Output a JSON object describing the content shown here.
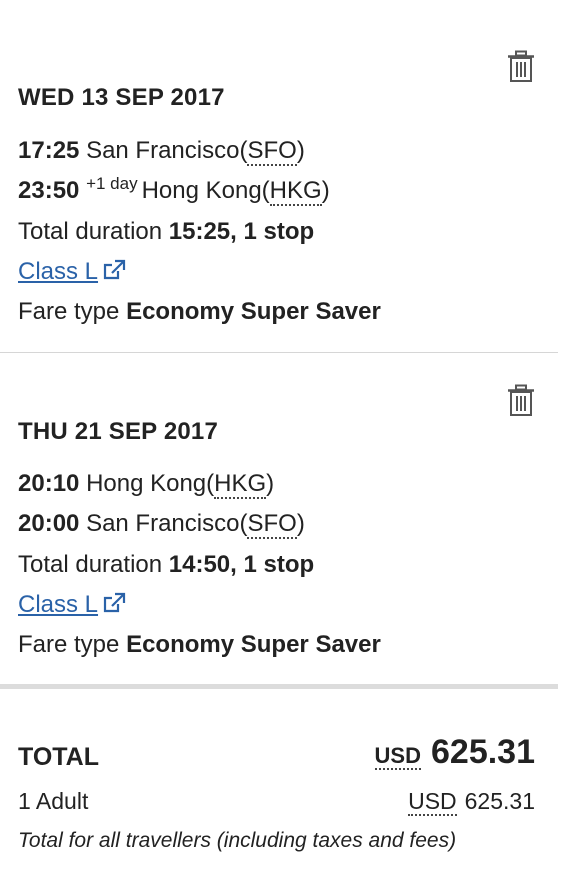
{
  "segments": [
    {
      "date": "WED 13 SEP 2017",
      "depart_time": "17:25",
      "depart_city": "San Francisco",
      "depart_code": "SFO",
      "arrive_time": "23:50",
      "arrive_day_offset": "+1 day",
      "arrive_city": "Hong Kong",
      "arrive_code": "HKG",
      "duration_label": "Total duration",
      "duration_value": "15:25, 1 stop",
      "class_link": "Class L",
      "fare_label": "Fare type",
      "fare_value": "Economy Super Saver"
    },
    {
      "date": "THU 21 SEP 2017",
      "depart_time": "20:10",
      "depart_city": "Hong Kong",
      "depart_code": "HKG",
      "arrive_time": "20:00",
      "arrive_city": "San Francisco",
      "arrive_code": "SFO",
      "duration_label": "Total duration",
      "duration_value": "14:50, 1 stop",
      "class_link": "Class L",
      "fare_label": "Fare type",
      "fare_value": "Economy Super Saver"
    }
  ],
  "total": {
    "label": "TOTAL",
    "currency": "USD",
    "amount": "625.31",
    "passengers": "1 Adult",
    "passenger_currency": "USD",
    "passenger_amount": "625.31",
    "note": "Total for all travellers (including taxes and fees)"
  },
  "colors": {
    "link": "#2a62a8",
    "text": "#222222",
    "divider": "#d6d6d6"
  },
  "icons": {
    "delete": "trash-icon",
    "external": "external-link-icon"
  }
}
